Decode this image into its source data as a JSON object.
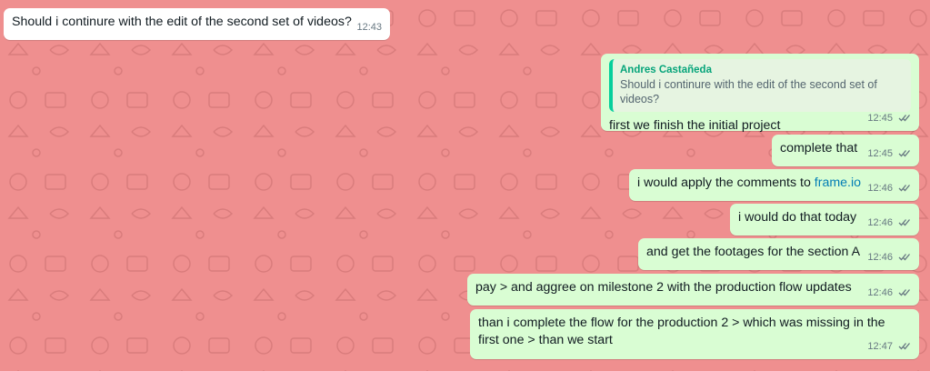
{
  "chat": {
    "background_color": "#ef8f8f",
    "incoming_color": "#ffffff",
    "outgoing_color": "#d9fdd3",
    "messages": [
      {
        "direction": "in",
        "text": "Should i continure with the edit of the second set of videos?",
        "time": "12:43"
      },
      {
        "direction": "out",
        "quote": {
          "author": "Andres Castañeda",
          "text": "Should i continure with the edit of the second set of videos?"
        },
        "text": "first we finish the initial project",
        "time": "12:45",
        "status": "read-double-tick"
      },
      {
        "direction": "out",
        "text": "complete that",
        "time": "12:45",
        "status": "read-double-tick"
      },
      {
        "direction": "out",
        "text_before_link": "i would apply the comments to ",
        "link": "frame.io",
        "time": "12:46",
        "status": "read-double-tick"
      },
      {
        "direction": "out",
        "text": "i would do that today",
        "time": "12:46",
        "status": "read-double-tick"
      },
      {
        "direction": "out",
        "text": "and get the footages for the section A",
        "time": "12:46",
        "status": "read-double-tick"
      },
      {
        "direction": "out",
        "text": "pay > and aggree on milestone 2 with the production flow updates",
        "time": "12:46",
        "status": "read-double-tick"
      },
      {
        "direction": "out",
        "text": "than i complete the flow for the production 2 > which was missing in the first one > than we start",
        "time": "12:47",
        "status": "read-double-tick"
      }
    ]
  }
}
